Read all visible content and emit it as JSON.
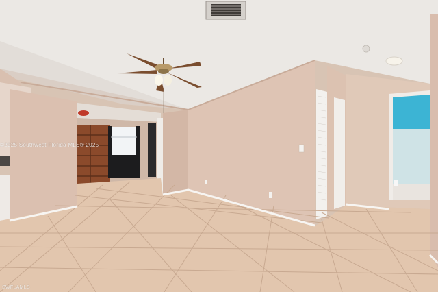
{
  "photo": {
    "subject": "empty room interior",
    "watermark_center": "©2025 Southwest Florida MLS® 2025",
    "watermark_corner": "SWFLAMLS"
  },
  "colors": {
    "ceiling": "#ece9e5",
    "wall": "#dcc2b2",
    "floor_tile": "#e2c6ae",
    "grout": "#c9ab93",
    "bathroom_wall": "#3cb4d4",
    "baseboard": "#f5f3f0"
  },
  "icons": [
    "ceiling-fan-icon",
    "air-vent-icon",
    "ceiling-light-icon",
    "smoke-detector-icon"
  ]
}
